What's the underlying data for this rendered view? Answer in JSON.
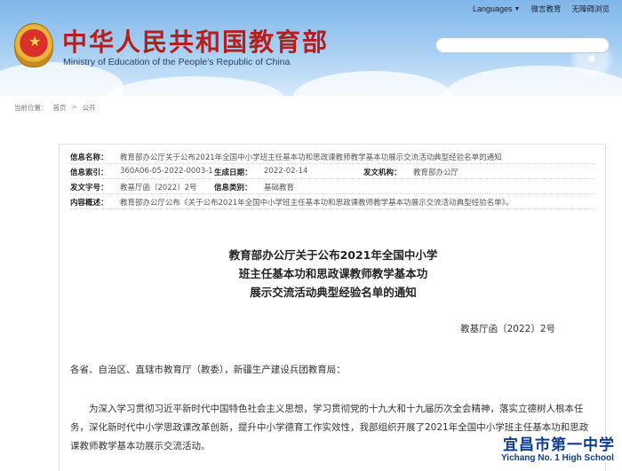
{
  "header": {
    "title": "中华人民共和国教育部",
    "subtitle": "Ministry of Education of the People's Republic of China",
    "nav": {
      "languages": "Languages",
      "weibo": "微言教育",
      "accessible": "无障碍浏览"
    },
    "search": {
      "placeholder": ""
    }
  },
  "breadcrumb": {
    "label": "当前位置：",
    "home": "首页",
    "sep": ">",
    "section": "公开"
  },
  "info": {
    "name_label": "信息名称：",
    "name_value": "教育部办公厅关于公布2021年全国中小学班主任基本功和思政课教师教学基本功展示交流活动典型经验名单的通知",
    "index_label": "信息索引：",
    "index_value": "360A06-05-2022-0003-1",
    "date_label": "生成日期：",
    "date_value": "2022-02-14",
    "org_label": "发文机构：",
    "org_value": "教育部办公厅",
    "doc_label": "发文字号：",
    "doc_value": "教基厅函〔2022〕2号",
    "cat_label": "信息类别：",
    "cat_value": "基础教育",
    "summary_label": "内容概述：",
    "summary_value": "教育部办公厅公布《关于公布2021年全国中小学班主任基本功和思政课教师教学基本功展示交流活动典型经验名单》。"
  },
  "document": {
    "title_line1": "教育部办公厅关于公布2021年全国中小学",
    "title_line2": "班主任基本功和思政课教师教学基本功",
    "title_line3": "展示交流活动典型经验名单的通知",
    "doc_number": "教基厅函〔2022〕2号",
    "salutation": "各省、自治区、直辖市教育厅（教委），新疆生产建设兵团教育局：",
    "paragraph1": "为深入学习贯彻习近平新时代中国特色社会主义思想，学习贯彻党的十九大和十九届历次全会精神，落实立德树人根本任务，深化新时代中小学思政课改革创新，提升中小学德育工作实效性，我部组织开展了2021年全国中小学班主任基本功和思政课教师教学基本功展示交流活动。"
  },
  "watermark": {
    "cn": "宜昌市第一中学",
    "en": "Yichang No. 1 High School"
  },
  "colors": {
    "title_red": "#b41f1b",
    "header_blue": "#7fb6e9",
    "watermark_blue": "#0e3e8c"
  }
}
